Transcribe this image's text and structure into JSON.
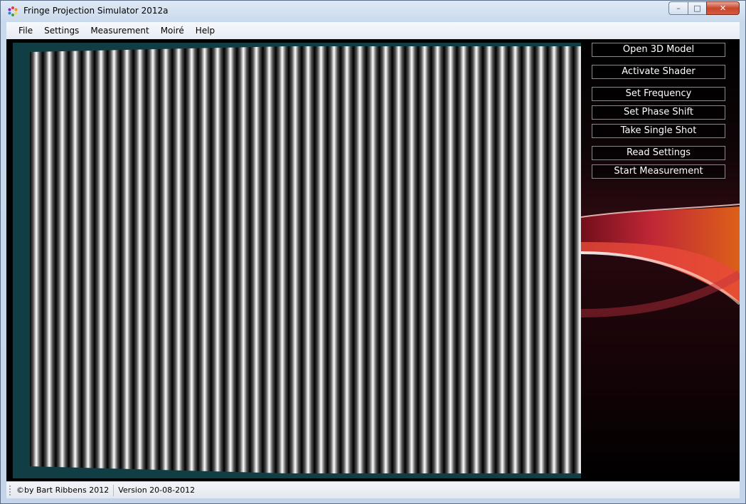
{
  "window": {
    "title": "Fringe Projection Simulator 2012a",
    "controls": {
      "minimize": "–",
      "maximize": "□",
      "close": "✕"
    }
  },
  "menu": [
    "File",
    "Settings",
    "Measurement",
    "Moiré",
    "Help"
  ],
  "buttons": {
    "open_model": "Open 3D Model",
    "activate_shader": "Activate Shader",
    "set_frequency": "Set Frequency",
    "set_phase_shift": "Set Phase Shift",
    "take_single_shot": "Take Single Shot",
    "read_settings": "Read Settings",
    "start_measurement": "Start Measurement"
  },
  "status": {
    "copyright": "©by Bart Ribbens 2012",
    "version": "Version 20-08-2012"
  },
  "colors": {
    "viewport_bg": "#113e44",
    "accent_red": "#d22a3a",
    "accent_orange": "#f06a1a"
  },
  "icons": [
    "app-icon",
    "minimize-icon",
    "maximize-icon",
    "close-icon",
    "status-grip-icon"
  ]
}
